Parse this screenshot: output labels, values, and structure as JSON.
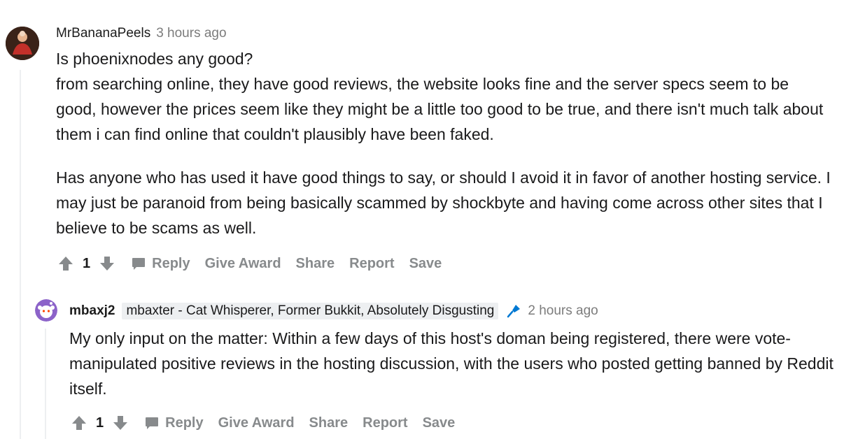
{
  "comments": [
    {
      "author": "MrBananaPeels",
      "timestamp": "3 hours ago",
      "paragraphs": [
        "Is phoenixnodes any good?",
        "from searching online, they have good reviews, the website looks fine and the server specs seem to be good, however the prices seem like they might be a little too good to be true, and there isn't much talk about them i can find online that couldn't plausibly have been faked.",
        "Has anyone who has used it have good things to say, or should I avoid it in favor of another hosting service. I may just be paranoid from being basically scammed by shockbyte and having come across other sites that I believe to be scams as well."
      ],
      "score": "1",
      "actions": {
        "reply": "Reply",
        "award": "Give Award",
        "share": "Share",
        "report": "Report",
        "save": "Save"
      }
    },
    {
      "author": "mbaxj2",
      "flair": "mbaxter - Cat Whisperer, Former Bukkit, Absolutely Disgusting",
      "timestamp": "2 hours ago",
      "paragraphs": [
        "My only input on the matter: Within a few days of this host's doman being registered, there were vote-manipulated positive reviews in the hosting discussion, with the users who posted getting banned by Reddit itself."
      ],
      "score": "1",
      "actions": {
        "reply": "Reply",
        "award": "Give Award",
        "share": "Share",
        "report": "Report",
        "save": "Save"
      }
    }
  ],
  "colors": {
    "meta_gray": "#7c7c7c",
    "action_gray": "#878a8c",
    "thread_line": "#edeff1",
    "flair_bg": "#edeff1",
    "mic_blue": "#0079d3"
  },
  "icons": [
    "avatar-photo",
    "snoo-avatar",
    "upvote-icon",
    "downvote-icon",
    "chat-bubble-icon",
    "microphone-icon"
  ]
}
